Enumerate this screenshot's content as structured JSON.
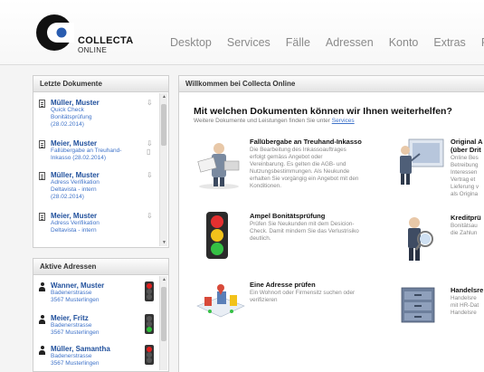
{
  "brand": {
    "name": "COLLECTA",
    "sub": "ONLINE",
    "accent": "#1f4f9c"
  },
  "nav": {
    "items": [
      "Desktop",
      "Services",
      "Fälle",
      "Adressen",
      "Konto",
      "Extras",
      "F"
    ]
  },
  "docs_panel": {
    "title": "Letzte Dokumente",
    "items": [
      {
        "name": "Müller, Muster",
        "lines": [
          "Quick Check",
          "Bonitätsprüfung",
          "(28.02.2014)"
        ]
      },
      {
        "name": "Meier, Muster",
        "lines": [
          "Fallübergabe an Treuhand-",
          "Inkasso (28.02.2014)"
        ]
      },
      {
        "name": "Müller, Muster",
        "lines": [
          "Adress Verifikation",
          "Deltavista - intern",
          "(28.02.2014)"
        ]
      },
      {
        "name": "Meier, Muster",
        "lines": [
          "Adress Verifikation",
          "Deltavista - intern"
        ]
      }
    ]
  },
  "addr_panel": {
    "title": "Aktive Adressen",
    "items": [
      {
        "name": "Wanner, Muster",
        "street": "Badenerstrasse",
        "city": "3567 Musterlingen",
        "status": "red"
      },
      {
        "name": "Meier, Fritz",
        "street": "Badenerstrasse",
        "city": "3567 Musterlingen",
        "status": "green"
      },
      {
        "name": "Müller, Samantha",
        "street": "Badenerstrasse",
        "city": "3567 Musterlingen",
        "status": "red"
      }
    ]
  },
  "welcome": {
    "panel_title": "Willkommen bei Collecta Online",
    "heading": "Mit welchen Dokumenten können wir Ihnen weiterhelfen?",
    "sub_text": "Weitere Dokumente und Leistungen finden Sie unter",
    "sub_link": "Services",
    "services": [
      {
        "title": "Fallübergabe an Treuhand-Inkasso",
        "desc": [
          "Die Bearbeitung des Inkassoauftrages",
          "erfolgt gemäss Angebot oder",
          "Vereinbarung. Es gelten die AGB- und",
          "Nutzungsbestimmungen. Als Neukunde",
          "erhalten Sie vorgängig ein Angebot mit den",
          "Konditionen."
        ]
      },
      {
        "title": "Original A",
        "title2": "(über Drit",
        "desc": [
          "Online Bes",
          "Betreibung",
          "Interessen",
          "Vertrag et",
          "Lieferung v",
          "als Origina"
        ]
      },
      {
        "title": "Ampel Bonitätsprüfung",
        "desc": [
          "Prüfen Sie Neukunden mit dem Desicion-",
          "Check. Damit mindern Sie das Verlustrisiko",
          "deutlich."
        ]
      },
      {
        "title": "Kreditprü",
        "desc": [
          "Bonitätsau",
          "die Zahlun"
        ]
      },
      {
        "title": "Eine Adresse prüfen",
        "desc": [
          "Ein Wohnort oder Firmensitz suchen oder",
          "verifizieren"
        ]
      },
      {
        "title": "Handelsre",
        "desc": [
          "Handelsre",
          "mit HR-Dat",
          "Handelsre"
        ]
      }
    ]
  }
}
